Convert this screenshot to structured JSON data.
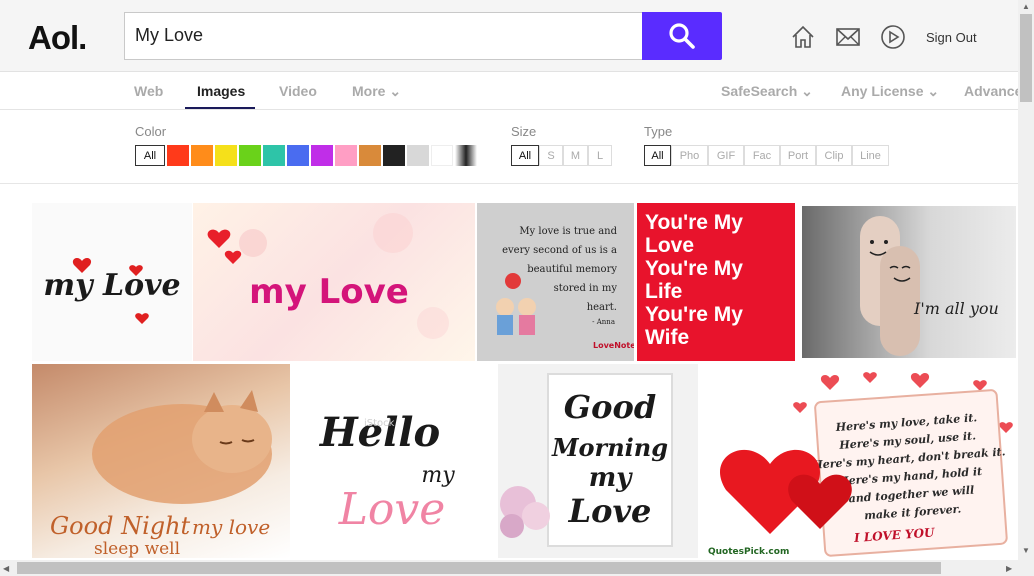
{
  "header": {
    "logo": "Aol.",
    "search_value": "My Love",
    "sign_out": "Sign Out",
    "accent": "#5a2cff"
  },
  "tabs": [
    {
      "label": "Web"
    },
    {
      "label": "Images"
    },
    {
      "label": "Video"
    },
    {
      "label": "More ⌄"
    },
    {
      "label": "SafeSearch ⌄"
    },
    {
      "label": "Any License ⌄"
    },
    {
      "label": "Advance"
    }
  ],
  "filters": {
    "color_label": "Color",
    "color_all": "All",
    "colors": [
      "#ff3a1a",
      "#ff8c1a",
      "#f5e01a",
      "#6ad21a",
      "#2ec4a8",
      "#4a6cf0",
      "#c02ee8",
      "#ff9ec4",
      "#d98a3a",
      "#222222",
      "#d8d8d8",
      "#ffffff"
    ],
    "size_label": "Size",
    "sizes": [
      "All",
      "S",
      "M",
      "L"
    ],
    "type_label": "Type",
    "types": [
      "All",
      "Pho",
      "GIF",
      "Fac",
      "Port",
      "Clip",
      "Line"
    ]
  },
  "images": {
    "t1": "my Love",
    "t2": "my Love",
    "t3_lines": [
      "My love is true and",
      "every second of us is a",
      "beautiful memory",
      "stored in my",
      "heart."
    ],
    "t3_author": "- Anna",
    "t3_brand": "LoveNote",
    "t4_lines": [
      "You're My",
      "Love",
      "You're My",
      "Life",
      "You're My",
      "Wife"
    ],
    "t5": "I'm all you",
    "t6_line1": "Good Night",
    "t6_line2": "my love",
    "t6_line3": "sleep well",
    "t7_line1": "Hello",
    "t7_line2": "my",
    "t7_line3": "Love",
    "t7_watermark": "iStock",
    "t8_lines": [
      "Good",
      "Morning",
      "my",
      "Love"
    ],
    "t9_lines": [
      "Here's my love, take it.",
      "Here's my soul, use it.",
      "Here's my heart, don't break it.",
      "Here's my hand, hold it",
      "and together we will",
      "make it forever."
    ],
    "t9_footer": "I LOVE YOU",
    "t9_brand": "QuotesPick.com"
  }
}
